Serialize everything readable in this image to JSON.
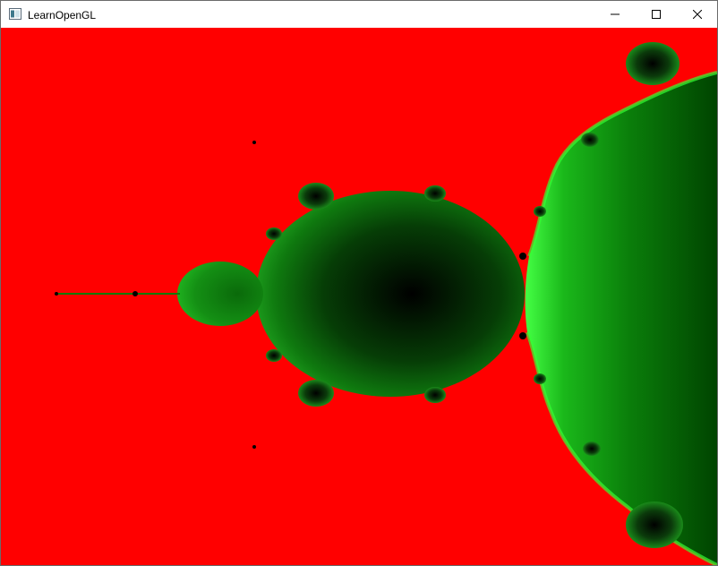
{
  "window": {
    "title": "LearnOpenGL",
    "controls": {
      "minimize_icon": "minimize-icon",
      "maximize_icon": "maximize-icon",
      "close_icon": "close-icon"
    }
  },
  "viewport": {
    "content": "mandelbrot-fractal-render",
    "colors": {
      "outside": "#ff0000",
      "inside_dark": "#000000",
      "inside_mid": "#006400",
      "edge_glow": "#33ff33"
    }
  }
}
